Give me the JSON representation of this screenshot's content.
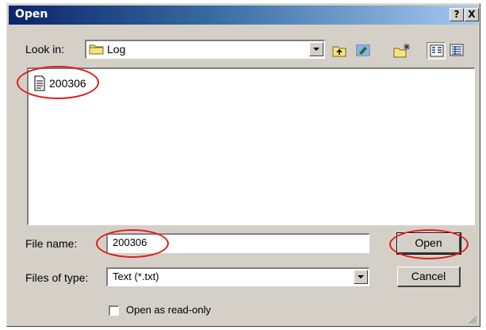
{
  "window": {
    "title": "Open",
    "help_label": "?",
    "close_label": "X"
  },
  "look_in": {
    "label": "Look in:",
    "value": "Log"
  },
  "toolbar": {
    "icons": [
      "up-folder-icon",
      "desktop-icon",
      "new-folder-icon",
      "list-view-icon",
      "details-view-icon"
    ]
  },
  "files": [
    {
      "name": "200306",
      "icon": "text-file-icon"
    }
  ],
  "file_name": {
    "label": "File name:",
    "value": "200306"
  },
  "files_of_type": {
    "label": "Files of type:",
    "value": "Text (*.txt)"
  },
  "read_only": {
    "label": "Open as read-only",
    "checked": false
  },
  "buttons": {
    "open_label": "Open",
    "cancel_label": "Cancel"
  },
  "colors": {
    "title_start": "#0a246a",
    "title_end": "#a6caf0",
    "face": "#d4d0c8",
    "annotation": "#e31b1b"
  }
}
